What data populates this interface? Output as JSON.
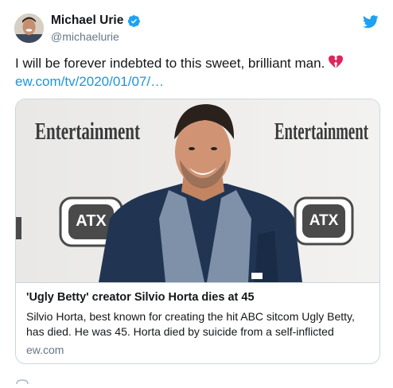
{
  "author": {
    "name": "Michael Urie",
    "handle": "@michaelurie",
    "verified": true,
    "avatar_icon": "profile-photo"
  },
  "platform_icon": "twitter-bird-icon",
  "tweet": {
    "text": "I will be forever indebted to this sweet, brilliant man.",
    "emoji": "broken-heart-icon",
    "link": "ew.com/tv/2020/01/07/…"
  },
  "card": {
    "image_brand_text": "Entertainment",
    "image_badge_text": "ATX",
    "title": "'Ugly Betty' creator Silvio Horta dies at 45",
    "description": "Silvio Horta, best known for creating the hit ABC sitcom Ugly Betty, has died. He was 45. Horta died by suicide from a self-inflicted",
    "domain": "ew.com"
  },
  "colors": {
    "link": "#1b95e0",
    "secondary_text": "#657786",
    "verified": "#1da1f2",
    "heart": "#e0245e",
    "border": "#ccd6dd"
  }
}
